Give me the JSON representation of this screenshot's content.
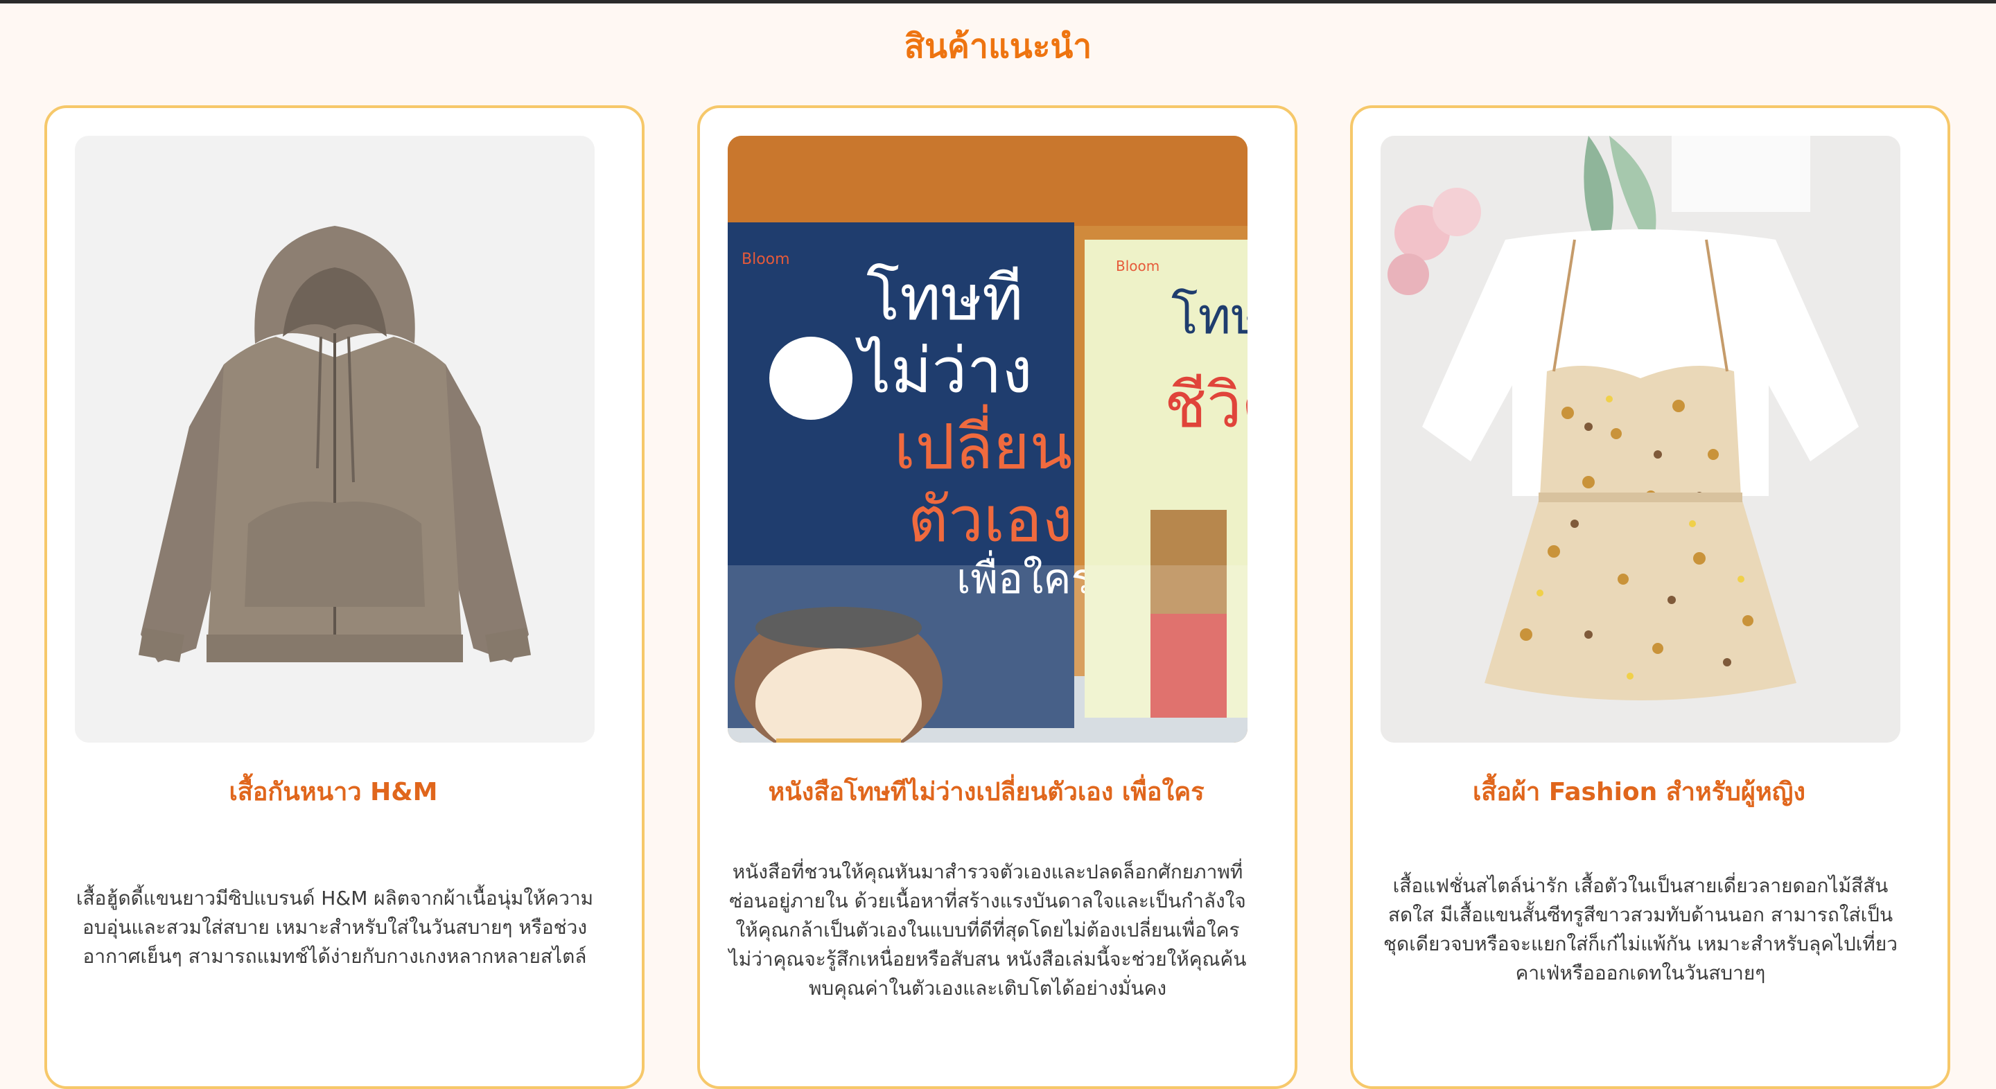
{
  "section": {
    "title": "สินค้าแนะนำ"
  },
  "theme": {
    "accent": "#ee7410",
    "card_border": "#f6c86a",
    "background": "#fff8f3"
  },
  "products": [
    {
      "title": "เสื้อกันหนาว H&M",
      "description": "เสื้อฮู้ดดี้แขนยาวมีซิปแบรนด์ H&M ผลิตจากผ้าเนื้อนุ่มให้ความอบอุ่นและสวมใส่สบาย เหมาะสำหรับใส่ในวันสบายๆ หรือช่วงอากาศเย็นๆ สามารถแมทช์ได้ง่ายกับกางเกงหลากหลายสไตล์",
      "image_icon": "hoodie-image"
    },
    {
      "title": "หนังสือโทษทีไม่ว่างเปลี่ยนตัวเอง เพื่อใคร",
      "description": "หนังสือที่ชวนให้คุณหันมาสำรวจตัวเองและปลดล็อกศักยภาพที่ซ่อนอยู่ภายใน ด้วยเนื้อหาที่สร้างแรงบันดาลใจและเป็นกำลังใจให้คุณกล้าเป็นตัวเองในแบบที่ดีที่สุดโดยไม่ต้องเปลี่ยนเพื่อใคร ไม่ว่าคุณจะรู้สึกเหนื่อยหรือสับสน หนังสือเล่มนี้จะช่วยให้คุณค้นพบคุณค่าในตัวเองและเติบโตได้อย่างมั่นคง",
      "image_icon": "book-image",
      "image_text": {
        "publisher": "Bloom",
        "cover_line1": "โทษที",
        "cover_line2": "ไม่ว่าง",
        "cover_line3": "เปลี่ยน",
        "cover_line4": "ตัวเอง",
        "cover_line5": "เพื่อใคร",
        "side_book_line1": "โทษ",
        "side_book_line2": "ชีวิต"
      }
    },
    {
      "title": "เสื้อผ้า Fashion สำหรับผู้หญิง",
      "description": "เสื้อแฟชั่นสไตล์น่ารัก เสื้อตัวในเป็นสายเดี่ยวลายดอกไม้สีสันสดใส มีเสื้อแขนสั้นซีทรูสีขาวสวมทับด้านนอก สามารถใส่เป็นชุดเดียวจบหรือจะแยกใส่ก็เก๋ไม่แพ้กัน เหมาะสำหรับลุคไปเที่ยวคาเฟ่หรือออกเดทในวันสบายๆ",
      "image_icon": "floral-dress-image"
    }
  ]
}
